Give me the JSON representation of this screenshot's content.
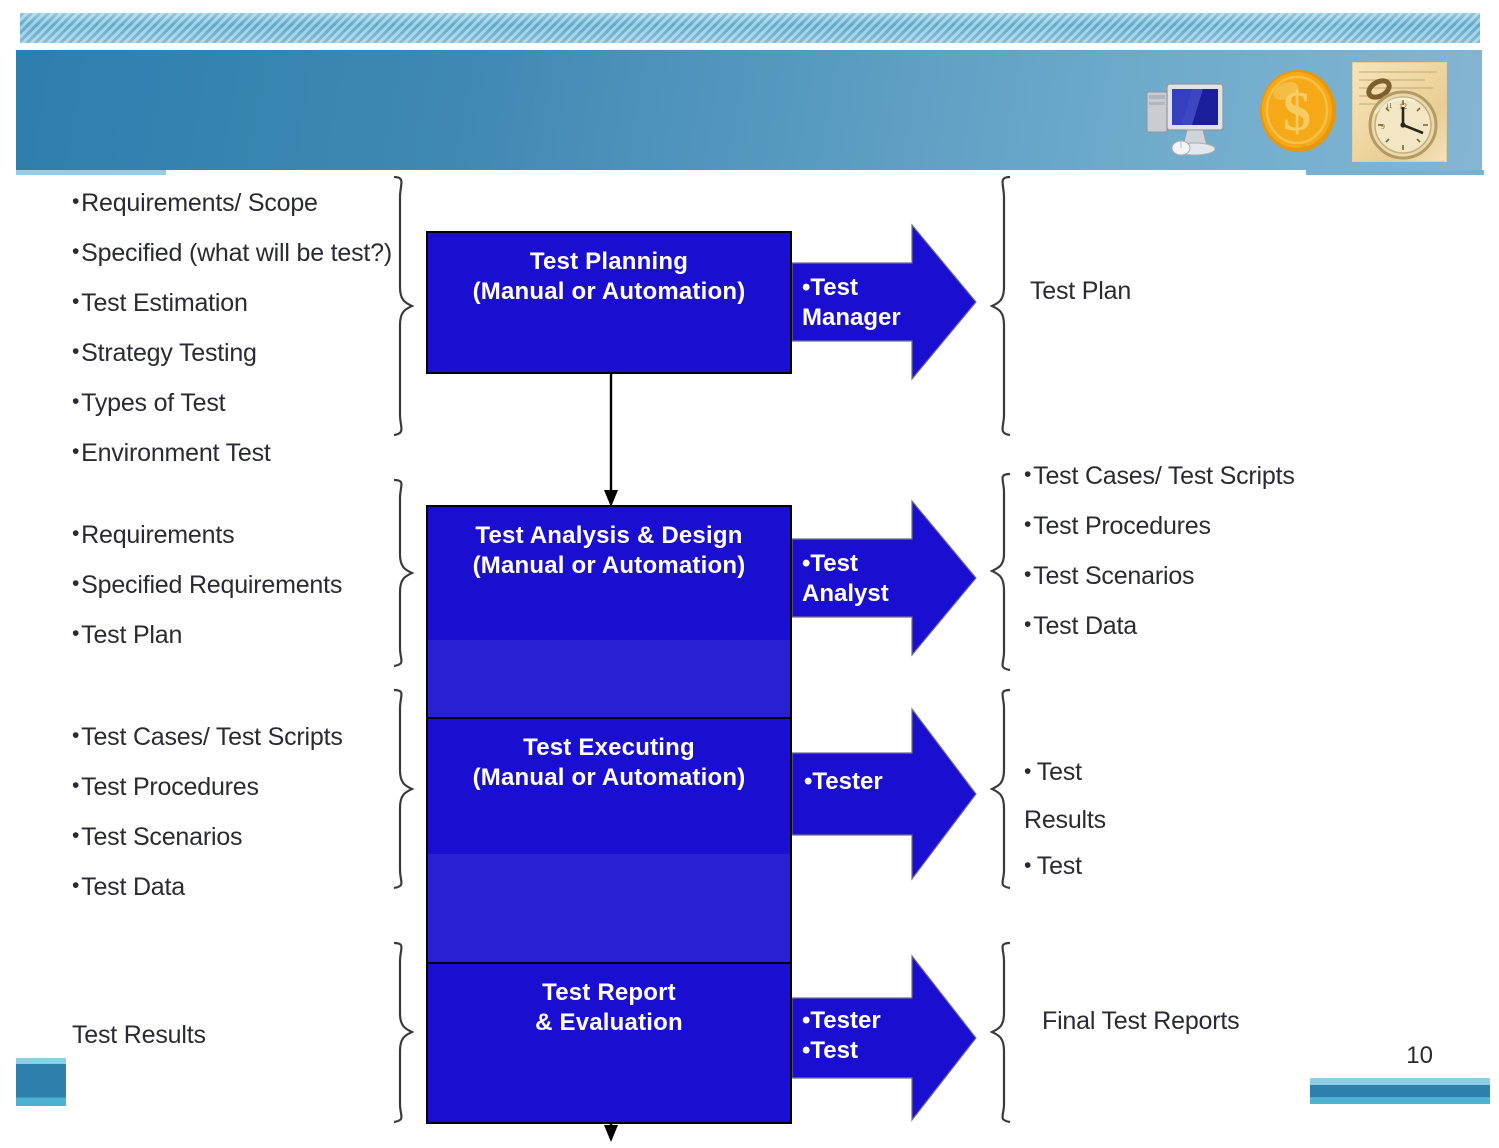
{
  "slide": {
    "number": "10",
    "accent_color": "#2f7fad",
    "process_box_color": "#1a0fd0",
    "text_color": "#2a2a33"
  },
  "header": {
    "icons": [
      {
        "name": "computer-monitor-icon",
        "label": "computer"
      },
      {
        "name": "dollar-coin-icon",
        "label": "dollar coin"
      },
      {
        "name": "pocket-watch-icon",
        "label": "pocket watch"
      }
    ]
  },
  "flow": {
    "rows": [
      {
        "id": "test-planning",
        "inputs": [
          "Requirements/ Scope",
          "Specified (what will be test?)",
          "Test Estimation",
          "Strategy Testing",
          "Types of Test",
          "Environment Test"
        ],
        "inputs_bulleted": true,
        "process_title": "Test Planning",
        "process_subtitle": "(Manual or Automation)",
        "role_label": "•Test\nManager",
        "outputs": [
          "Test Plan"
        ],
        "outputs_bulleted": false
      },
      {
        "id": "test-analysis-design",
        "inputs": [
          "Requirements",
          "Specified Requirements",
          "Test Plan"
        ],
        "inputs_bulleted": true,
        "process_title": "Test Analysis & Design",
        "process_subtitle": "(Manual or Automation)",
        "role_label": "•Test\nAnalyst",
        "outputs": [
          "Test Cases/ Test Scripts",
          "Test Procedures",
          "Test Scenarios",
          "Test Data"
        ],
        "outputs_bulleted": true
      },
      {
        "id": "test-executing",
        "inputs": [
          "Test Cases/ Test Scripts",
          "Test Procedures",
          "Test Scenarios",
          "Test Data"
        ],
        "inputs_bulleted": true,
        "process_title": "Test Executing",
        "process_subtitle": "(Manual or Automation)",
        "role_label": "•Tester",
        "outputs": [
          "Test",
          "Results",
          "Test"
        ],
        "outputs_bulleted": true
      },
      {
        "id": "test-report-evaluation",
        "inputs": [
          "Test Results"
        ],
        "inputs_bulleted": false,
        "process_title": "Test Report",
        "process_subtitle": "& Evaluation",
        "role_label": "•Tester\n•Test",
        "outputs": [
          "Final Test Reports"
        ],
        "outputs_bulleted": false
      }
    ]
  }
}
